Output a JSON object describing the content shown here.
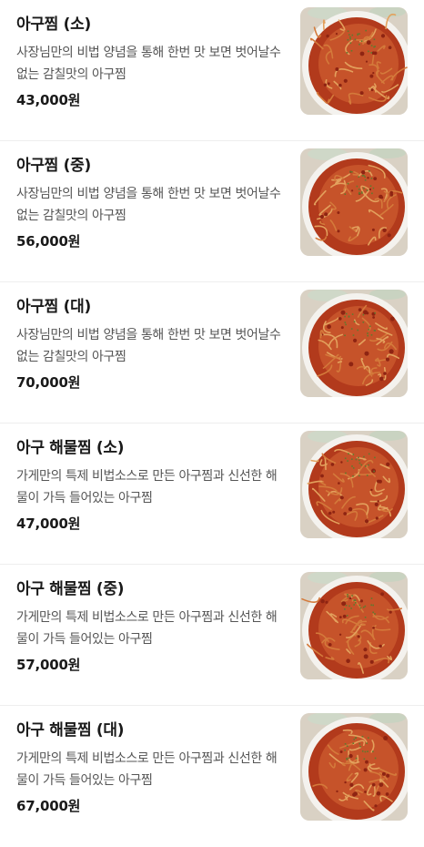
{
  "menu": {
    "items": [
      {
        "name": "아구찜 (소)",
        "description": "사장님만의 비법 양념을 통해 한번 맛 보면 벗어날수없는 감칠맛의 아구찜",
        "price": "43,000원",
        "image": "braised-monkfish-photo"
      },
      {
        "name": "아구찜 (중)",
        "description": "사장님만의 비법 양념을 통해 한번 맛 보면 벗어날수없는 감칠맛의 아구찜",
        "price": "56,000원",
        "image": "braised-monkfish-photo"
      },
      {
        "name": "아구찜 (대)",
        "description": "사장님만의 비법 양념을 통해 한번 맛 보면 벗어날수없는 감칠맛의 아구찜",
        "price": "70,000원",
        "image": "braised-monkfish-photo"
      },
      {
        "name": "아구 해물찜 (소)",
        "description": "가게만의 특제 비법소스로 만든 아구찜과 신선한 해물이 가득 들어있는 아구찜",
        "price": "47,000원",
        "image": "braised-monkfish-photo"
      },
      {
        "name": "아구 해물찜 (중)",
        "description": "가게만의 특제 비법소스로 만든 아구찜과 신선한 해물이 가득 들어있는 아구찜",
        "price": "57,000원",
        "image": "braised-monkfish-photo"
      },
      {
        "name": "아구 해물찜 (대)",
        "description": "가게만의 특제 비법소스로 만든 아구찜과 신선한 해물이 가득 들어있는 아구찜",
        "price": "67,000원",
        "image": "braised-monkfish-photo"
      }
    ]
  }
}
